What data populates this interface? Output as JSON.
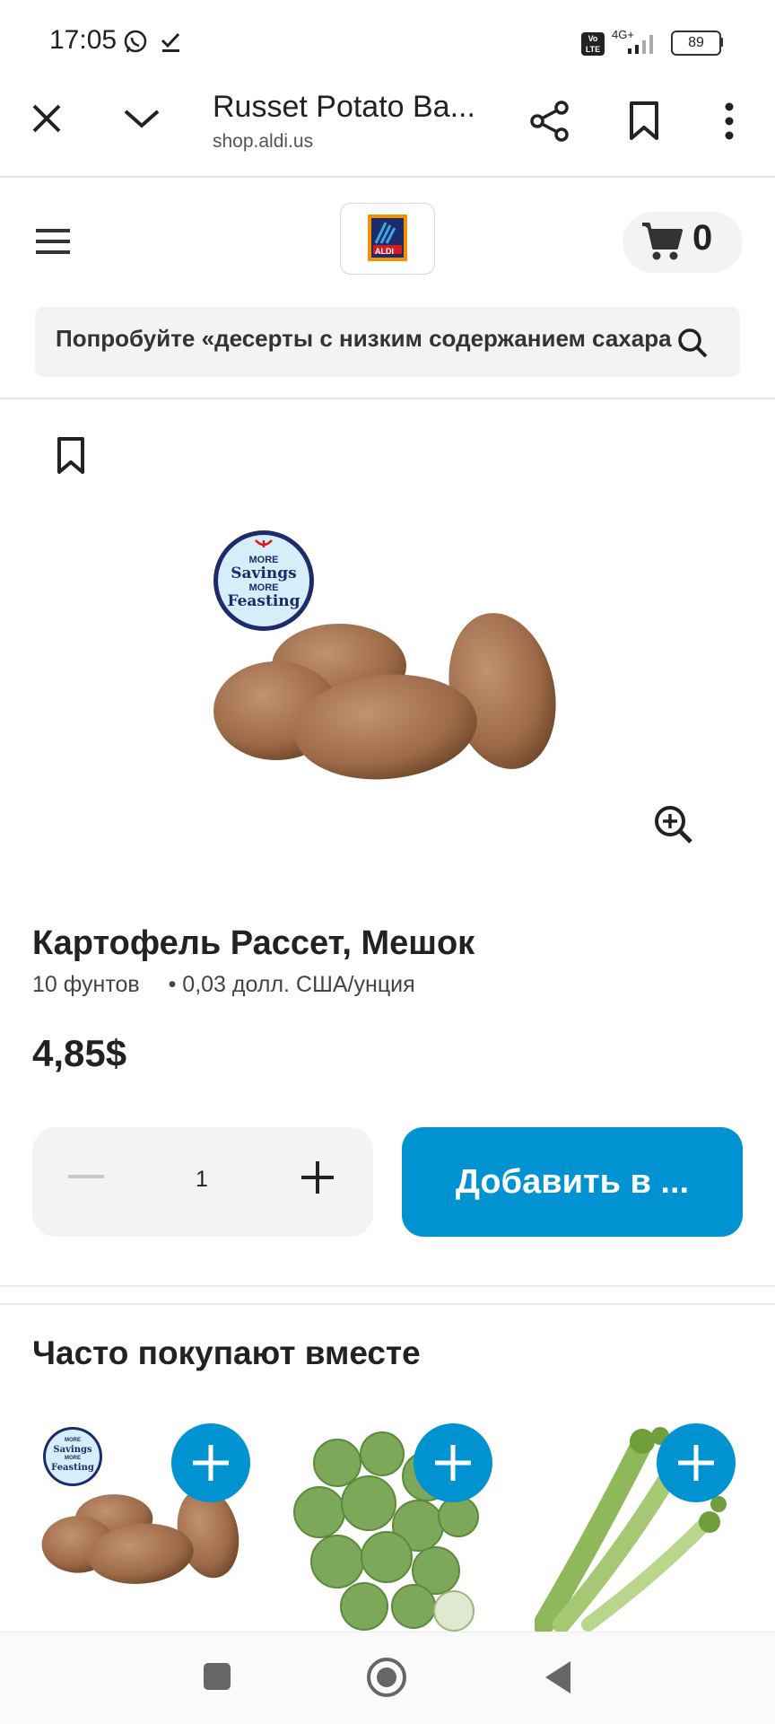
{
  "status_bar": {
    "time": "17:05",
    "icons": [
      "whatsapp-icon",
      "check-icon",
      "volte-icon",
      "signal-4g-icon"
    ],
    "signal_label": "4G+",
    "volte_label": "Vo LTE",
    "battery": "89"
  },
  "tab": {
    "title": "Russet Potato Ba...",
    "url": "shop.aldi.us"
  },
  "header": {
    "logo_text": "ALDI",
    "cart_count": "0",
    "search_placeholder": "Попробуйте «десерты с низким содержанием сахара ..."
  },
  "product": {
    "badge_line1": "MORE",
    "badge_line2": "Savings",
    "badge_line3": "MORE",
    "badge_line4": "Feasting",
    "name": "Картофель Рассет, Мешок",
    "size": "10 фунтов",
    "unit_price": "• 0,03 долл. США/унция",
    "price": "4,85$",
    "quantity": "1",
    "add_label": "Добавить в ..."
  },
  "related": {
    "title": "Часто покупают вместе",
    "items": [
      {
        "name": "potato-bag"
      },
      {
        "name": "brussels-sprouts"
      },
      {
        "name": "celery"
      }
    ]
  },
  "colors": {
    "accent": "#0192d1",
    "surface": "#f2f3f5",
    "logo_blue": "#1d2a6b",
    "logo_orange": "#f39200"
  }
}
